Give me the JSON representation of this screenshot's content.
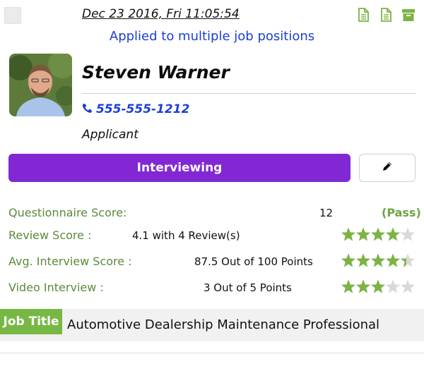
{
  "header": {
    "datetime": "Dec 23 2016, Fri 11:05:54",
    "applied_note": "Applied to multiple job positions",
    "icons": [
      "document-icon",
      "document-icon",
      "archive-icon"
    ]
  },
  "candidate": {
    "name": "Steven Warner",
    "phone": "555-555-1212",
    "role": "Applicant",
    "status": "Interviewing"
  },
  "scores": [
    {
      "label": "Questionnaire Score:",
      "value": "12",
      "result": "(Pass)"
    },
    {
      "label": "Review Score :",
      "value": "4.1 with 4 Review(s)",
      "rating": 4.1,
      "max": 5
    },
    {
      "label": "Avg. Interview Score :",
      "value": "87.5 Out of 100 Points",
      "rating": 4.4,
      "max": 5
    },
    {
      "label": "Video Interview :",
      "value": "3 Out of 5 Points",
      "rating": 3,
      "max": 5
    }
  ],
  "job": {
    "tag": "Job Title",
    "value": "Automotive Dealership Maintenance Professional"
  },
  "colors": {
    "accent_green": "#77b844",
    "label_green": "#5b8a3a",
    "status_purple": "#8128d4",
    "link_blue": "#1b3fd6",
    "star_filled": "#7cb342",
    "star_empty": "#d9d9d9"
  }
}
